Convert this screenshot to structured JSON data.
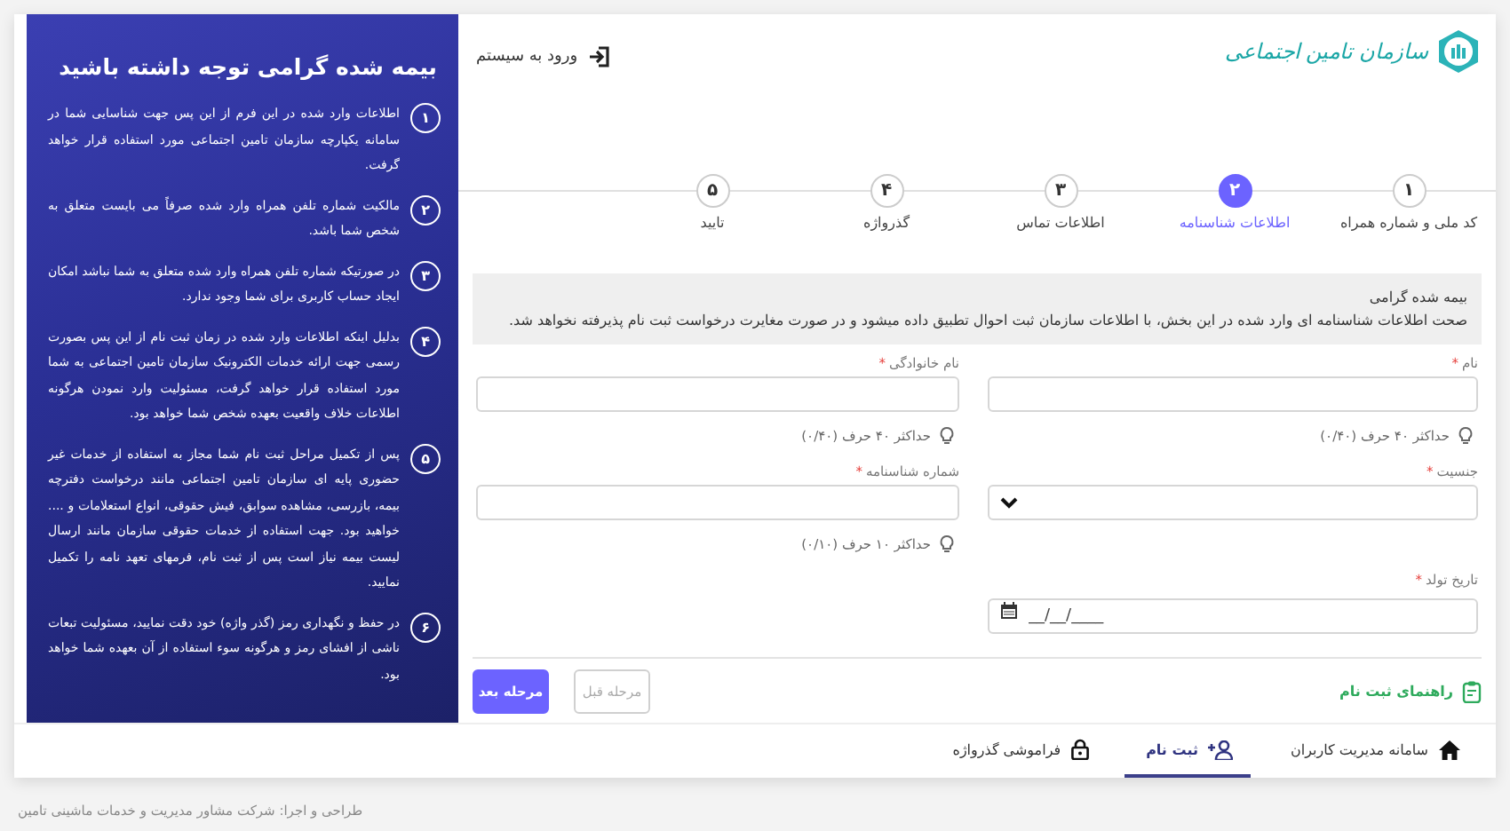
{
  "header": {
    "logo_text": "سازمان تامین اجتماعی",
    "login_link": "ورود به سیستم"
  },
  "steps": [
    {
      "number": "۱",
      "label": "کد ملی و شماره همراه",
      "selected": false
    },
    {
      "number": "۲",
      "label": "اطلاعات شناسنامه",
      "selected": true
    },
    {
      "number": "۳",
      "label": "اطلاعات تماس",
      "selected": false
    },
    {
      "number": "۴",
      "label": "گذرواژه",
      "selected": false
    },
    {
      "number": "۵",
      "label": "تایید",
      "selected": false
    }
  ],
  "notice": {
    "title": "بیمه شده گرامی",
    "text": "صحت اطلاعات شناسنامه ای وارد شده در این بخش، با اطلاعات سازمان ثبت احوال تطبیق داده میشود و در صورت مغایرت درخواست ثبت نام پذیرفته نخواهد شد."
  },
  "fields": [
    {
      "kind": "text",
      "label": "نام",
      "required_mark": "*",
      "hint": "حداکثر ۴۰ حرف (۰/۴۰)"
    },
    {
      "kind": "text",
      "label": "نام خانوادگی",
      "required_mark": "*",
      "hint": "حداکثر ۴۰ حرف (۰/۴۰)"
    },
    {
      "kind": "select",
      "label": "جنسیت",
      "required_mark": "*"
    },
    {
      "kind": "text",
      "label": "شماره شناسنامه",
      "required_mark": "*",
      "hint": "حداکثر ۱۰ حرف (۰/۱۰)"
    },
    {
      "kind": "date",
      "label": "تاریخ تولد",
      "required_mark": "*",
      "placeholder": "__/__/____"
    }
  ],
  "actions": {
    "guide_link": "راهنمای ثبت نام",
    "previous": {
      "label": "مرحله قبل",
      "disabled": true
    },
    "next": {
      "label": "مرحله بعد",
      "disabled": false
    }
  },
  "nav": [
    {
      "kind": "home",
      "label": "سامانه مدیریت کاربران",
      "selected": false
    },
    {
      "kind": "register",
      "label": "ثبت نام",
      "selected": true
    },
    {
      "kind": "password",
      "label": "فراموشی گذرواژه",
      "selected": false
    }
  ],
  "sidebar": {
    "title": "بیمه شده گرامی توجه داشته باشید",
    "items": [
      {
        "number": "۱",
        "text": "اطلاعات وارد شده در این فرم از این پس جهت شناسایی شما در سامانه یکپارچه سازمان تامین اجتماعی مورد استفاده قرار خواهد گرفت."
      },
      {
        "number": "۲",
        "text": "مالکیت شماره تلفن همراه وارد شده صرفاً می بایست متعلق به شخص شما باشد."
      },
      {
        "number": "۳",
        "text": "در صورتیکه شماره تلفن همراه وارد شده متعلق به شما نباشد امکان ایجاد حساب کاربری برای شما وجود ندارد."
      },
      {
        "number": "۴",
        "text": "بدلیل اینکه اطلاعات وارد شده در زمان ثبت نام از این پس بصورت رسمی جهت ارائه خدمات الکترونیک سازمان تامین اجتماعی به شما مورد استفاده قرار خواهد گرفت، مسئولیت وارد نمودن هرگونه اطلاعات خلاف واقعیت بعهده شخص شما خواهد بود."
      },
      {
        "number": "۵",
        "text": "پس از تکمیل مراحل ثبت نام شما مجاز به استفاده از خدمات غیر حضوری پایه ای سازمان تامین اجتماعی مانند درخواست دفترچه بیمه، بازرسی، مشاهده سوابق، فیش حقوقی، انواع استعلامات و .... خواهید بود. جهت استفاده از خدمات حقوقی سازمان مانند ارسال لیست بیمه نیاز است پس از ثبت نام، فرمهای تعهد نامه را تکمیل نمایید."
      },
      {
        "number": "۶",
        "text": "در حفظ و نگهداری رمز (گذر واژه) خود دقت نمایید، مسئولیت تبعات ناشی از افشای رمز و هرگونه سوء استفاده از آن بعهده شما خواهد بود."
      }
    ]
  },
  "footer": "طراحی و اجرا: شرکت مشاور مدیریت و خدمات ماشینی تامین"
}
